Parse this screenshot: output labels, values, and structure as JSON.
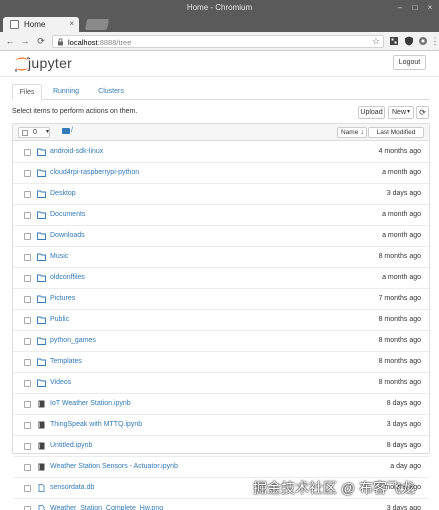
{
  "window": {
    "title": "Home - Chromium"
  },
  "tab": {
    "title": "Home",
    "close": "×"
  },
  "address": {
    "host": "localhost",
    "path": ":8888/tree"
  },
  "jupyter": {
    "brand": "jupyter",
    "logout": "Logout"
  },
  "tabs": [
    {
      "label": "Files",
      "active": true
    },
    {
      "label": "Running",
      "active": false
    },
    {
      "label": "Clusters",
      "active": false
    }
  ],
  "hint": "Select items to perform actions on them.",
  "actions": {
    "upload": "Upload",
    "new": "New",
    "new_caret": "▾",
    "refresh": "⟳"
  },
  "listhead": {
    "count": "0",
    "caret": "▾",
    "path_sep": "/",
    "sort_name": "Name",
    "sort_arrow": "↓",
    "sort_modified": "Last Modified"
  },
  "files": [
    {
      "name": "android-sdk-linux",
      "type": "folder",
      "modified": "4 months ago"
    },
    {
      "name": "cloud4rpi-raspberrypi-python",
      "type": "folder",
      "modified": "a month ago"
    },
    {
      "name": "Desktop",
      "type": "folder",
      "modified": "3 days ago"
    },
    {
      "name": "Documents",
      "type": "folder",
      "modified": "a month ago"
    },
    {
      "name": "Downloads",
      "type": "folder",
      "modified": "a month ago"
    },
    {
      "name": "Music",
      "type": "folder",
      "modified": "8 months ago"
    },
    {
      "name": "oldconffiles",
      "type": "folder",
      "modified": "a month ago"
    },
    {
      "name": "Pictures",
      "type": "folder",
      "modified": "7 months ago"
    },
    {
      "name": "Public",
      "type": "folder",
      "modified": "8 months ago"
    },
    {
      "name": "python_games",
      "type": "folder",
      "modified": "8 months ago"
    },
    {
      "name": "Templates",
      "type": "folder",
      "modified": "8 months ago"
    },
    {
      "name": "Videos",
      "type": "folder",
      "modified": "8 months ago"
    },
    {
      "name": "IoT Weather Station.ipynb",
      "type": "notebook",
      "modified": "8 days ago"
    },
    {
      "name": "ThingSpeak with MTTQ.ipynb",
      "type": "notebook",
      "modified": "3 days ago"
    },
    {
      "name": "Untitled.ipynb",
      "type": "notebook",
      "modified": "8 days ago"
    },
    {
      "name": "Weather Station Sensors - Actuator.ipynb",
      "type": "notebook",
      "modified": "a day ago"
    },
    {
      "name": "sensordata.db",
      "type": "file",
      "modified": "4 months ago"
    },
    {
      "name": "Weather_Station_Complete_Hw.png",
      "type": "file",
      "modified": "3 days ago"
    }
  ],
  "watermark": "掘金技术社区 @ 布客飞龙",
  "colors": {
    "link": "#337ab7",
    "jupyter_orange": "#f37726"
  }
}
